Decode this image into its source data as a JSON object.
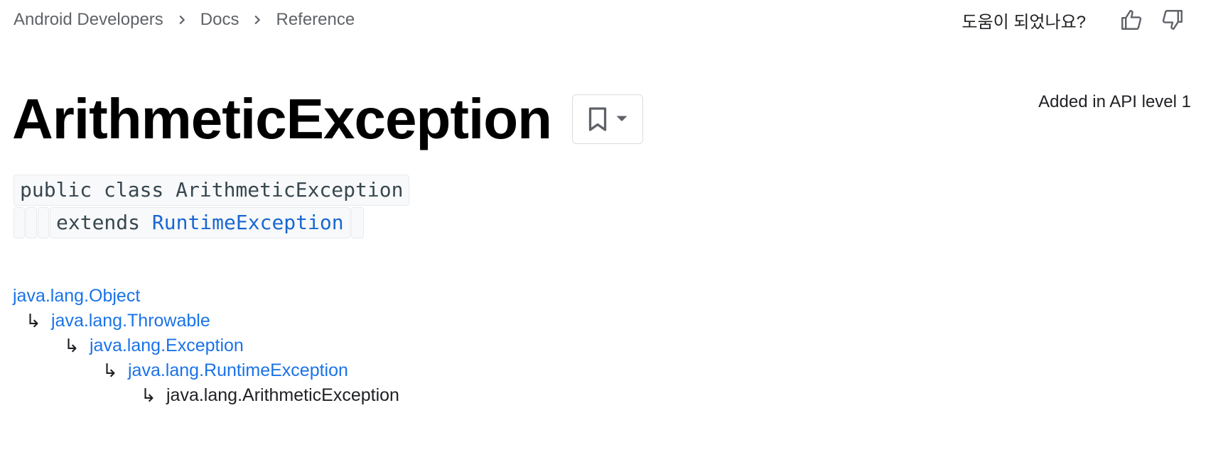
{
  "breadcrumb": {
    "items": [
      "Android Developers",
      "Docs",
      "Reference"
    ]
  },
  "feedback": {
    "label": "도움이 되었나요?",
    "like_icon": "thumb-up-icon",
    "dislike_icon": "thumb-down-icon"
  },
  "header": {
    "title": "ArithmeticException",
    "api_level": "Added in API level 1",
    "bookmark_icon": "bookmark-icon"
  },
  "signature": {
    "line1": "public class ArithmeticException",
    "extends_keyword": "extends",
    "extends_class": "RuntimeException"
  },
  "hierarchy": {
    "arrow": "↳",
    "items": [
      "java.lang.Object",
      "java.lang.Throwable",
      "java.lang.Exception",
      "java.lang.RuntimeException",
      "java.lang.ArithmeticException"
    ]
  },
  "colors": {
    "link": "#1a73e8",
    "text": "#202124",
    "muted": "#5f6368",
    "code_bg": "#f8f9fa"
  }
}
